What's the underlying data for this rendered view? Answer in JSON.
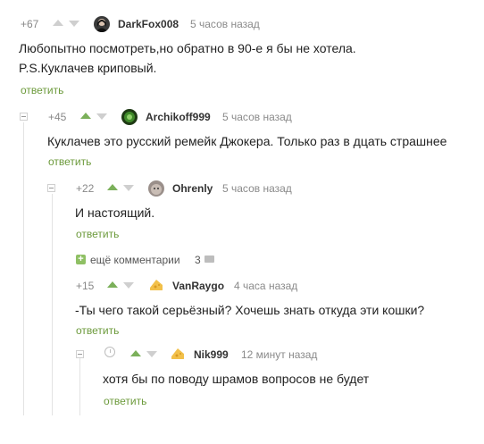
{
  "colors": {
    "accent": "#6c9a3b",
    "upvote": "#7bb05a",
    "muted": "#8a8a8a"
  },
  "comments": [
    {
      "rating": "+67",
      "user": "DarkFox008",
      "time": "5 часов назад",
      "avatar": "avatar-girl-icon",
      "lines": [
        "Любопытно посмотреть,но обратно в 90-е я бы не хотела.",
        "P.S.Куклачев криповый."
      ],
      "reply": "ответить"
    },
    {
      "rating": "+45",
      "user": "Archikoff999",
      "time": "5 часов назад",
      "avatar": "avatar-green-icon",
      "lines": [
        "Куклачев это русский ремейк Джокера. Только раз в дцать страшнее"
      ],
      "reply": "ответить"
    },
    {
      "rating": "+22",
      "user": "Ohrenly",
      "time": "5 часов назад",
      "avatar": "avatar-cat-icon",
      "lines": [
        "И настоящий."
      ],
      "reply": "ответить"
    },
    {
      "rating": "+15",
      "user": "VanRaygo",
      "time": "4 часа назад",
      "avatar": "avatar-cheese-icon",
      "lines": [
        "-Ты чего такой серьёзный? Хочешь знать откуда эти кошки?"
      ],
      "reply": "ответить"
    },
    {
      "rating": "",
      "user": "Nik999",
      "time": "12 минут назад",
      "avatar": "avatar-cheese-icon",
      "lines": [
        "хотя бы по поводу шрамов вопросов не будет"
      ],
      "reply": "ответить"
    }
  ],
  "more_comments": {
    "label": "ещё комментарии",
    "count": "3"
  }
}
